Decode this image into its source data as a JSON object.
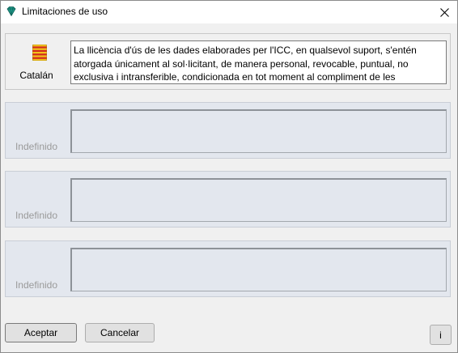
{
  "window": {
    "title": "Limitaciones de uso",
    "icon": "gem-icon"
  },
  "languages": [
    {
      "label": "Catalán",
      "flag": "catalan-flag-icon",
      "text": "La llicència d'ús de les dades elaborades per l'ICC, en qualsevol suport, s'entén atorgada únicament al sol·licitant, de manera personal, revocable, puntual, no exclusiva i intransferible, condicionada en tot moment al compliment de les",
      "enabled": true
    },
    {
      "label": "Indefinido",
      "text": "",
      "enabled": false
    },
    {
      "label": "Indefinido",
      "text": "",
      "enabled": false
    },
    {
      "label": "Indefinido",
      "text": "",
      "enabled": false
    }
  ],
  "buttons": {
    "accept_label": "Aceptar",
    "cancel_label": "Cancelar",
    "info_label": "i"
  },
  "colors": {
    "flag_yellow": "#f2c21b",
    "flag_red": "#d22b1f",
    "gem_teal": "#1f9a8a"
  }
}
